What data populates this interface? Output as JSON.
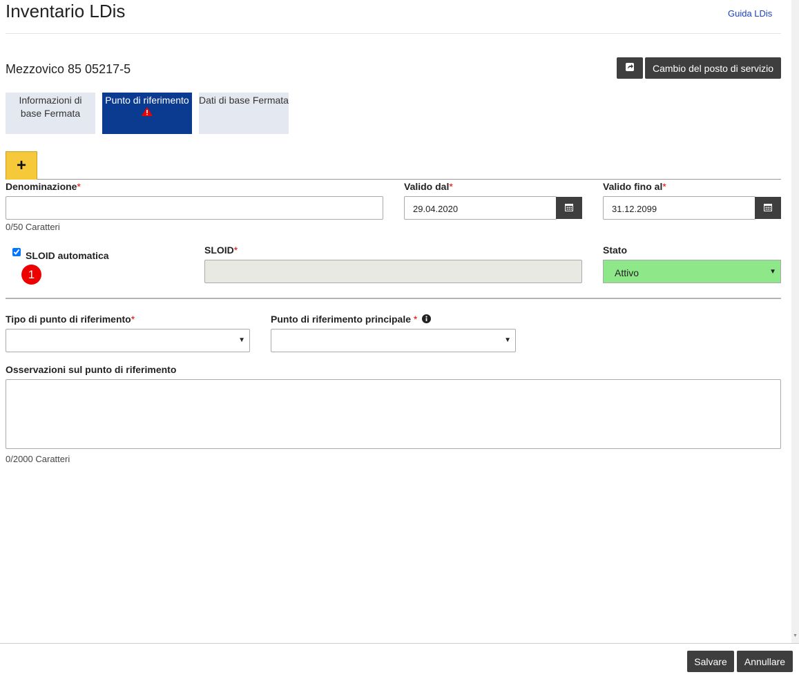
{
  "header": {
    "title": "Inventario LDis",
    "help_link": "Guida LDis"
  },
  "station": {
    "name": "Mezzovico 85 05217-5",
    "change_button": "Cambio del posto di servizio",
    "icon": "share-icon"
  },
  "tabs": [
    {
      "label": "Informazioni di base Fermata",
      "active": false
    },
    {
      "label": "Punto di riferimento",
      "active": true,
      "icon": "warning-icon"
    },
    {
      "label": "Dati di base Fermata",
      "active": false
    }
  ],
  "add_button": "+",
  "form": {
    "denominazione": {
      "label": "Denominazione",
      "required": "*",
      "value": "",
      "hint": "0/50 Caratteri"
    },
    "valido_dal": {
      "label": "Valido dal",
      "required": "*",
      "value": "29.04.2020",
      "icon": "calendar-icon"
    },
    "valido_fino": {
      "label": "Valido fino al",
      "required": "*",
      "value": "31.12.2099",
      "icon": "calendar-icon"
    },
    "sloid_auto": {
      "label": "SLOID automatica",
      "checked": true,
      "badge": "1"
    },
    "sloid": {
      "label": "SLOID",
      "required": "*",
      "value": ""
    },
    "stato": {
      "label": "Stato",
      "value": "Attivo",
      "color": "#8ee88a"
    },
    "tipo": {
      "label": "Tipo di punto di riferimento",
      "required": "*",
      "value": ""
    },
    "principale": {
      "label": "Punto di riferimento principale",
      "required": "*",
      "value": "",
      "icon": "info-icon"
    },
    "osservazioni": {
      "label": "Osservazioni sul punto di riferimento",
      "value": "",
      "hint": "0/2000 Caratteri"
    }
  },
  "footer": {
    "save": "Salvare",
    "cancel": "Annullare"
  },
  "colors": {
    "active_tab": "#0b3a91",
    "add_tab": "#f6c93a",
    "dark_button": "#3e3e3e",
    "required": "#ee0000",
    "badge": "#ee0000"
  }
}
